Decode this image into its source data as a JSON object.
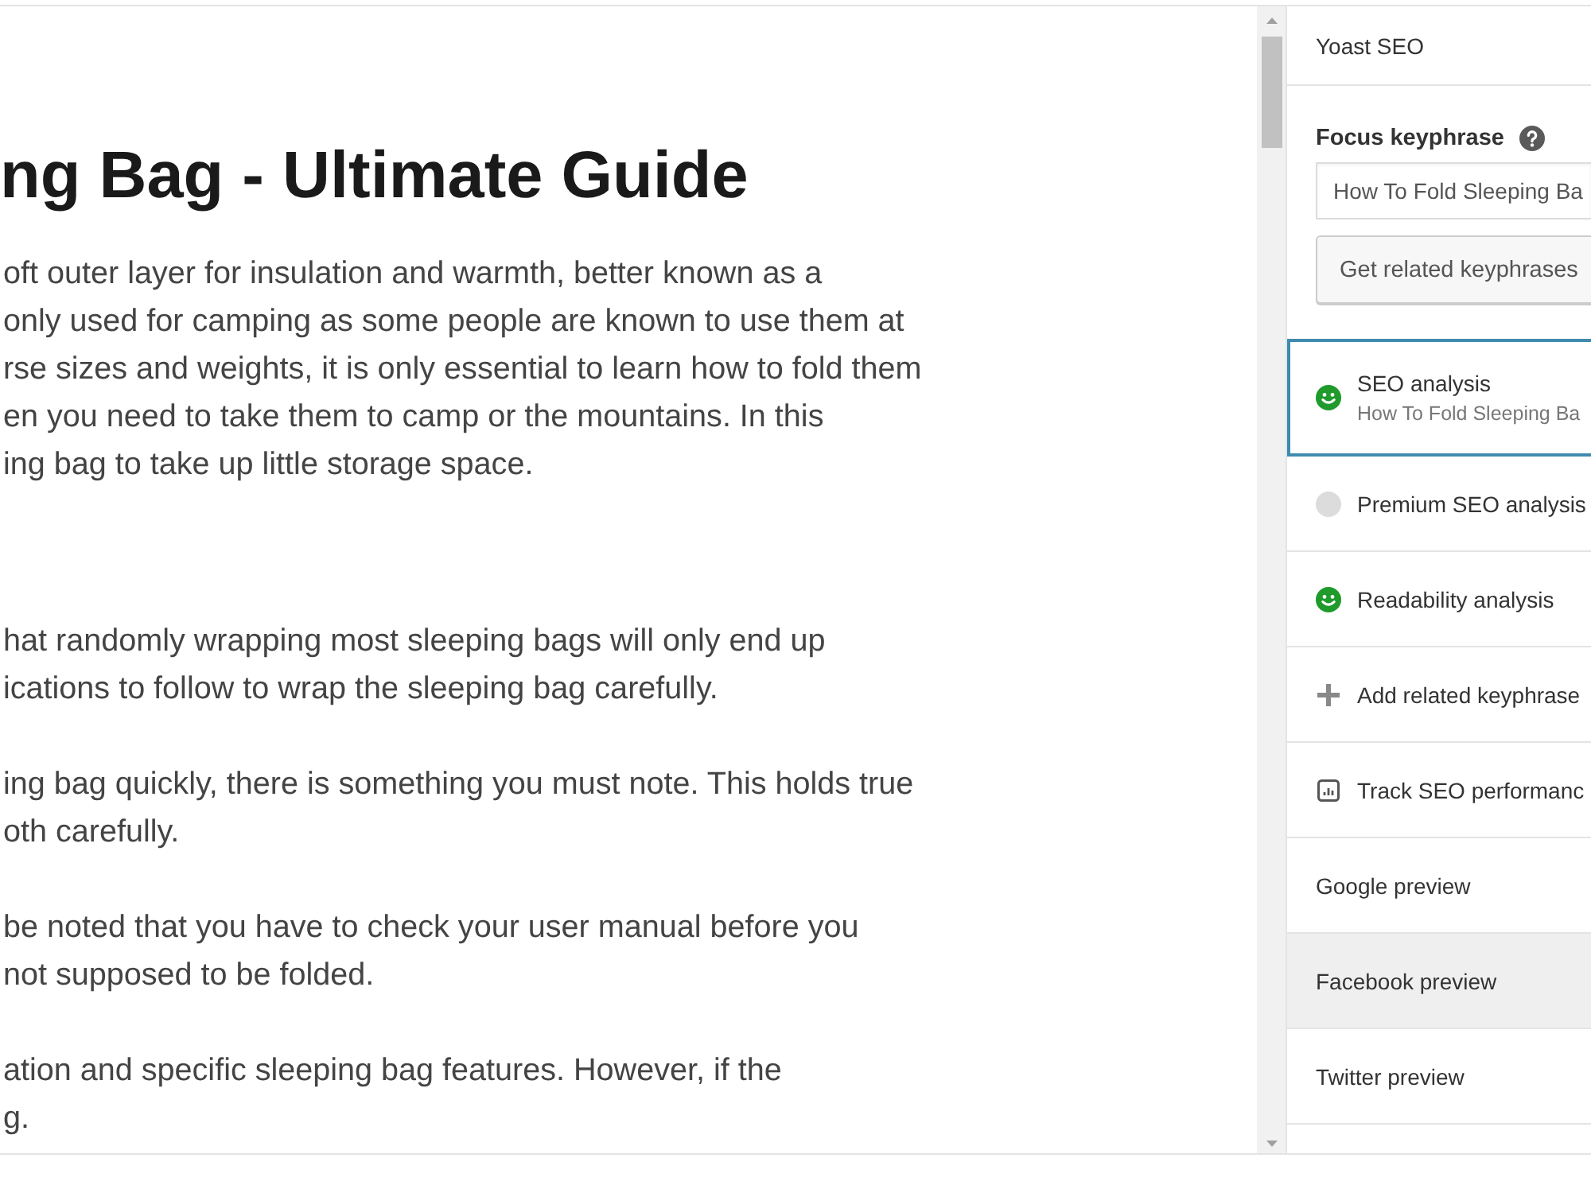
{
  "editor": {
    "title": "ng Bag - Ultimate Guide",
    "paragraphs": [
      [
        "oft outer layer for insulation and warmth, better known as a",
        "only used for camping as some people are known to use them at",
        "rse sizes and weights, it is only essential to learn how to fold them",
        "en you need to take them to camp or the mountains. In this",
        "ing bag to take up little storage space."
      ],
      [
        "hat randomly wrapping most sleeping bags will only end up",
        "ications to follow to wrap the sleeping bag carefully."
      ],
      [
        "ing bag quickly, there is something you must note. This holds true",
        "oth carefully."
      ],
      [
        "be noted that you have to check your user manual before you",
        "not supposed to be folded."
      ],
      [
        "ation and specific sleeping bag features. However, if the",
        "g."
      ]
    ]
  },
  "sidebar": {
    "title": "Yoast SEO",
    "focus_keyphrase": {
      "label": "Focus keyphrase",
      "value": "How To Fold Sleeping Ba"
    },
    "related_button": "Get related keyphrases",
    "sections": [
      {
        "kind": "score",
        "title": "SEO analysis",
        "subtitle": "How To Fold Sleeping Ba",
        "scored": true,
        "focused": true,
        "highlighted": false
      },
      {
        "kind": "score",
        "title": "Premium SEO analysis",
        "scored": false,
        "focused": false,
        "highlighted": false
      },
      {
        "kind": "score",
        "title": "Readability analysis",
        "scored": true,
        "focused": false,
        "highlighted": false
      },
      {
        "kind": "add",
        "title": "Add related keyphrase",
        "focused": false,
        "highlighted": false
      },
      {
        "kind": "track",
        "title": "Track SEO performanc",
        "focused": false,
        "highlighted": false
      },
      {
        "kind": "preview",
        "title": "Google preview",
        "focused": false,
        "highlighted": false
      },
      {
        "kind": "preview",
        "title": "Facebook preview",
        "focused": false,
        "highlighted": true
      },
      {
        "kind": "preview",
        "title": "Twitter preview",
        "focused": false,
        "highlighted": false
      }
    ]
  }
}
